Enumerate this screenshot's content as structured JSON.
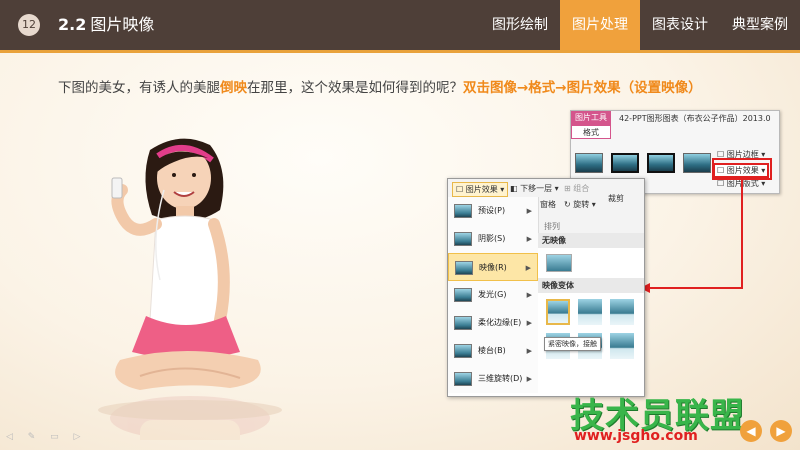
{
  "header": {
    "slide_number": "12",
    "section_number": "2.2",
    "section_title": "图片映像",
    "tabs": [
      {
        "label": "图形绘制",
        "active": false
      },
      {
        "label": "图片处理",
        "active": true
      },
      {
        "label": "图表设计",
        "active": false
      },
      {
        "label": "典型案例",
        "active": false
      }
    ]
  },
  "question": {
    "part1": "下图的美女，有诱人的美腿",
    "highlight1": "倒映",
    "part2": "在那里，这个效果是如何得到的呢？",
    "highlight2": "双击图像→格式→图片效果（设置映像）"
  },
  "ribbon": {
    "tool_tag": "图片工具",
    "doc_title": "42-PPT图形图表（布衣公子作品）2013.0",
    "format_tab": "格式",
    "border_btn": "图片边框",
    "effects_btn": "图片效果",
    "layout_btn": "图片版式"
  },
  "menu": {
    "effects_btn": "图片效果",
    "send_back": "下移一层",
    "combine": "组合",
    "align": "窗格",
    "rotate": "旋转",
    "crop": "裁剪",
    "arrange": "排列",
    "items": [
      {
        "label": "预设(P)"
      },
      {
        "label": "阴影(S)"
      },
      {
        "label": "映像(R)"
      },
      {
        "label": "发光(G)"
      },
      {
        "label": "柔化边缘(E)"
      },
      {
        "label": "棱台(B)"
      },
      {
        "label": "三维旋转(D)"
      }
    ],
    "submenu": {
      "no_reflection": "无映像",
      "variants": "映像变体",
      "tooltip": "紧密映像，接触"
    }
  },
  "footer": {
    "watermark": "技术员联盟",
    "url": "www.jsgho.com",
    "prev": "◀",
    "next": "▶"
  },
  "colors": {
    "header_bg": "#4e3f38",
    "accent": "#f0a13c",
    "highlight_text": "#f08a1c",
    "callout": "#e02020"
  }
}
